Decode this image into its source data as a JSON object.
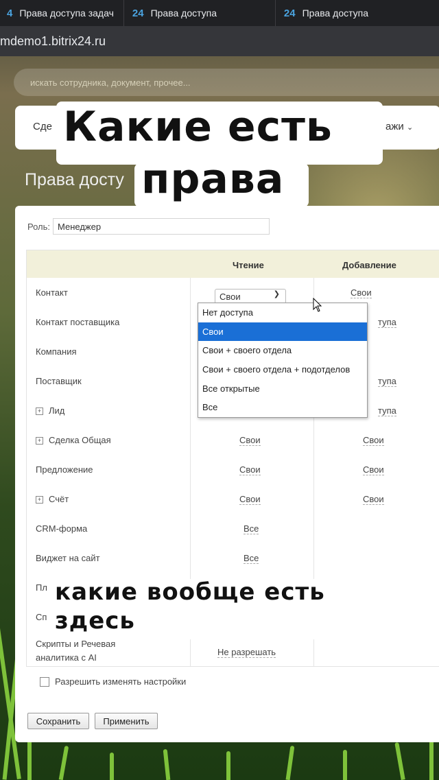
{
  "browser": {
    "tabs": [
      {
        "favicon": "4",
        "title": "Права доступа задач"
      },
      {
        "favicon": "24",
        "title": "Права доступа"
      },
      {
        "favicon": "24",
        "title": "Права доступа"
      }
    ],
    "url": "mdemo1.bitrix24.ru"
  },
  "header": {
    "search_placeholder": "искать сотрудника, документ, прочее...",
    "menu_left": "Сде",
    "menu_right": "ажи",
    "page_title": "Права досту"
  },
  "overlay": {
    "line1": "Какие есть",
    "line2": "права",
    "line3": "какие вообще есть",
    "line4": "здесь"
  },
  "role": {
    "label": "Роль:",
    "value": "Менеджер"
  },
  "columns": {
    "read": "Чтение",
    "add": "Добавление"
  },
  "rows": [
    {
      "label": "Контакт",
      "read": "Свои",
      "add": "Свои",
      "expandable": false
    },
    {
      "label": "Контакт поставщика",
      "read": "",
      "add": "тупа",
      "expandable": false
    },
    {
      "label": "Компания",
      "read": "",
      "add": "",
      "expandable": false
    },
    {
      "label": "Поставщик",
      "read": "",
      "add": "тупа",
      "expandable": false
    },
    {
      "label": "Лид",
      "read": "",
      "add": "тупа",
      "expandable": true
    },
    {
      "label": "Сделка Общая",
      "read": "Свои",
      "add": "Свои",
      "expandable": true
    },
    {
      "label": "Предложение",
      "read": "Свои",
      "add": "Свои",
      "expandable": false
    },
    {
      "label": "Счёт",
      "read": "Свои",
      "add": "Свои",
      "expandable": true
    },
    {
      "label": "CRM-форма",
      "read": "Все",
      "add": "",
      "expandable": false
    },
    {
      "label": "Виджет на сайт",
      "read": "Все",
      "add": "",
      "expandable": false
    },
    {
      "label": "Пл",
      "read": "",
      "add": "",
      "expandable": false
    },
    {
      "label": "Сп",
      "read": "",
      "add": "",
      "expandable": false
    },
    {
      "label": "Скрипты и Речевая",
      "label2": "аналитика с AI",
      "read": "Не разрешать",
      "add": "",
      "expandable": false
    }
  ],
  "dropdown": {
    "selected": "Свои",
    "options": [
      "Нет доступа",
      "Свои",
      "Свои + своего отдела",
      "Свои + своего отдела + подотделов",
      "Все открытые",
      "Все"
    ]
  },
  "allow_change": "Разрешить изменять настройки",
  "buttons": {
    "save": "Сохранить",
    "apply": "Применить"
  }
}
